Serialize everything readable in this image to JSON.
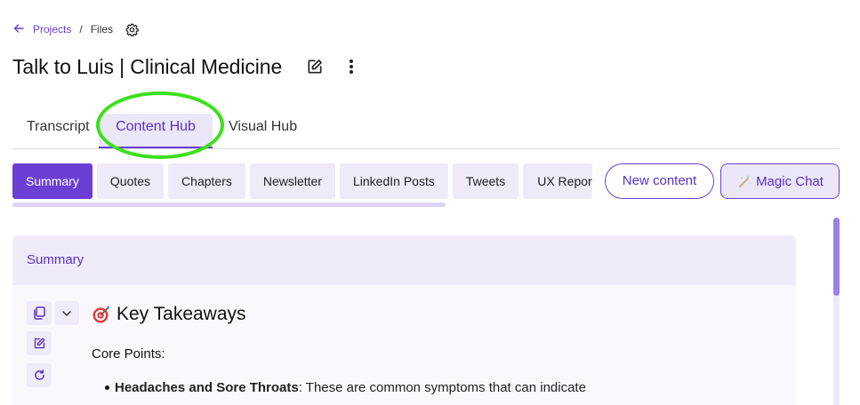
{
  "breadcrumb": {
    "back_icon": "arrow-left-icon",
    "projects_label": "Projects",
    "separator": "/",
    "current": "Files",
    "settings_icon": "gear-icon"
  },
  "header": {
    "title": "Talk to Luis | Clinical Medicine",
    "edit_icon": "edit-square-icon",
    "more_icon": "more-vertical-icon"
  },
  "tabs": [
    {
      "label": "Transcript",
      "active": false
    },
    {
      "label": "Content Hub",
      "active": true
    },
    {
      "label": "Visual Hub",
      "active": false
    }
  ],
  "subtabs": [
    {
      "label": "Summary",
      "active": true
    },
    {
      "label": "Quotes"
    },
    {
      "label": "Chapters"
    },
    {
      "label": "Newsletter"
    },
    {
      "label": "LinkedIn Posts"
    },
    {
      "label": "Tweets"
    },
    {
      "label": "UX Report"
    }
  ],
  "actions": {
    "new_content": "New content",
    "magic_chat": "Magic Chat",
    "magic_icon": "sparkle-icon"
  },
  "panel": {
    "header": "Summary",
    "heading": "Key Takeaways",
    "heading_icon": "target-dart-icon",
    "subheading": "Core Points:",
    "bullets": [
      {
        "bold": "Headaches and Sore Throats",
        "text": ": These are common symptoms that can indicate"
      }
    ]
  },
  "colors": {
    "accent": "#6b3fd4",
    "accent_light": "#ece7f8",
    "highlight": "#3be01a"
  }
}
